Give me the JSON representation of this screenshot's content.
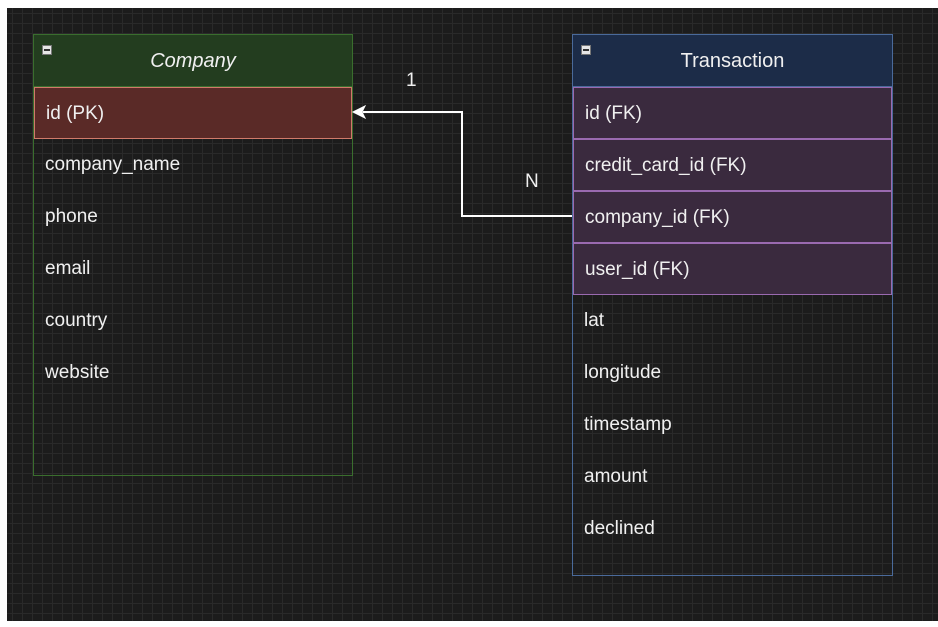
{
  "tables": {
    "company": {
      "title": "Company",
      "fields": [
        "id (PK)",
        "company_name",
        "phone",
        "email",
        "country",
        "website"
      ]
    },
    "transaction": {
      "title": "Transaction",
      "fields": [
        "id (FK)",
        "credit_card_id (FK)",
        "company_id (FK)",
        "user_id (FK)",
        "lat",
        "longitude",
        "timestamp",
        "amount",
        "declined"
      ]
    }
  },
  "relationship": {
    "from_table": "Transaction",
    "from_field": "company_id (FK)",
    "to_table": "Company",
    "to_field": "id (PK)",
    "source_cardinality": "N",
    "target_cardinality": "1"
  },
  "colors": {
    "canvas": "#1c1c1c",
    "company_border": "#3a6e2e",
    "company_header": "#233d1f",
    "pk_fill": "#5a2a27",
    "pk_border": "#d07a6a",
    "transaction_border": "#4a6a9a",
    "transaction_header": "#1c2c48",
    "fk_fill": "#3a2a3e",
    "fk_border": "#9a6ab0",
    "edge": "#ffffff"
  },
  "icons": {
    "collapse": "minus-square-icon",
    "arrowhead": "arrow-left-icon"
  }
}
